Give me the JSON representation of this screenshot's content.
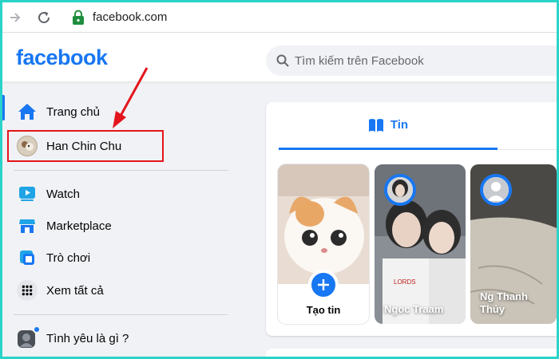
{
  "browser": {
    "url": "facebook.com",
    "back_icon": "arrow-right-icon",
    "reload_icon": "reload-icon",
    "lock_icon": "lock-icon"
  },
  "header": {
    "logo": "facebook",
    "search_placeholder": "Tìm kiếm trên Facebook",
    "brand_color": "#1877f2"
  },
  "sidebar": {
    "items": [
      {
        "label": "Trang chủ",
        "icon": "home-icon"
      },
      {
        "label": "Han Chin Chu",
        "icon": "avatar"
      },
      {
        "label": "Watch",
        "icon": "watch-icon"
      },
      {
        "label": "Marketplace",
        "icon": "marketplace-icon"
      },
      {
        "label": "Trò chơi",
        "icon": "gaming-icon"
      },
      {
        "label": "Xem tất cả",
        "icon": "grid-icon"
      },
      {
        "label": "Tình yêu là gì ?",
        "icon": "group-avatar"
      }
    ]
  },
  "stories": {
    "tab_label": "Tin",
    "create_label": "Tạo tin",
    "items": [
      {
        "name": "Ngoc Traam"
      },
      {
        "name": "Ng Thanh Thủy"
      }
    ]
  },
  "annotation": {
    "highlight_color": "#e4141c"
  }
}
